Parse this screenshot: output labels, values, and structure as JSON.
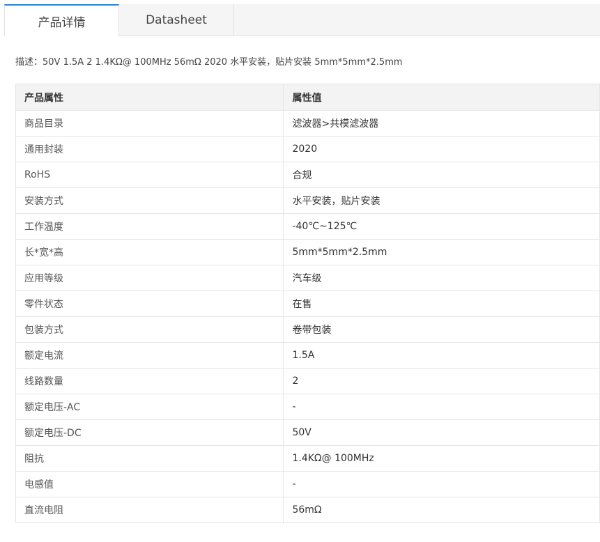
{
  "tabs": [
    {
      "label": "产品详情",
      "active": true
    },
    {
      "label": "Datasheet",
      "active": false
    }
  ],
  "description": "描述：50V 1.5A 2 1.4KΩ@ 100MHz 56mΩ 2020 水平安装，贴片安装 5mm*5mm*2.5mm",
  "table": {
    "headers": [
      "产品属性",
      "属性值"
    ],
    "rows": [
      [
        "商品目录",
        "滤波器>共模滤波器"
      ],
      [
        "通用封装",
        "2020"
      ],
      [
        "RoHS",
        "合规"
      ],
      [
        "安装方式",
        "水平安装，贴片安装"
      ],
      [
        "工作温度",
        "-40℃~125℃"
      ],
      [
        "长*宽*高",
        "5mm*5mm*2.5mm"
      ],
      [
        "应用等级",
        "汽车级"
      ],
      [
        "零件状态",
        "在售"
      ],
      [
        "包装方式",
        "卷带包装"
      ],
      [
        "额定电流",
        "1.5A"
      ],
      [
        "线路数量",
        "2"
      ],
      [
        "额定电压-AC",
        "-"
      ],
      [
        "额定电压-DC",
        "50V"
      ],
      [
        "阻抗",
        "1.4KΩ@ 100MHz"
      ],
      [
        "电感值",
        "-"
      ],
      [
        "直流电阻",
        "56mΩ"
      ]
    ]
  },
  "colors": {
    "accent": "#1e88e5",
    "header_bg": "#f3f3f3",
    "border": "#e6e6e6"
  }
}
